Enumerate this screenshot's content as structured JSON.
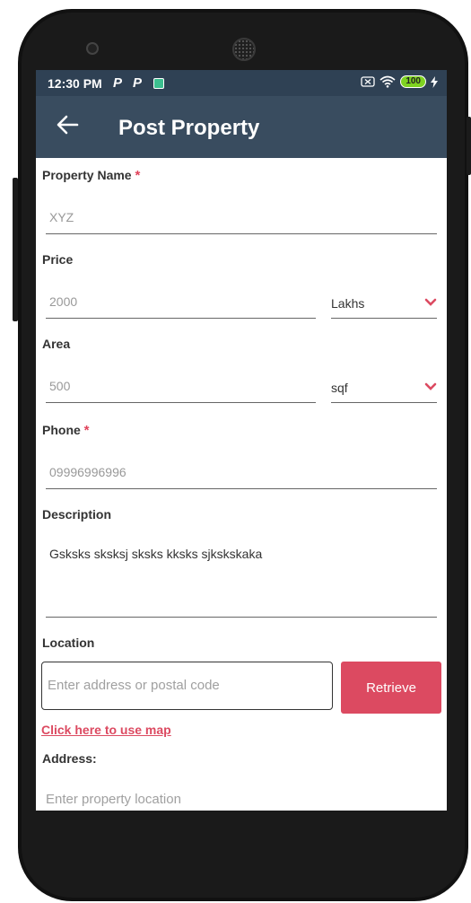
{
  "status_bar": {
    "time": "12:30 PM",
    "notif_icons": [
      "P",
      "P"
    ],
    "battery": "100"
  },
  "app_bar": {
    "title": "Post Property"
  },
  "form": {
    "property_name": {
      "label": "Property Name",
      "required_mark": "*",
      "value": "XYZ"
    },
    "price": {
      "label": "Price",
      "value": "2000",
      "unit": "Lakhs"
    },
    "area": {
      "label": "Area",
      "value": "500",
      "unit": "sqf"
    },
    "phone": {
      "label": "Phone",
      "required_mark": "*",
      "value": "09996996996"
    },
    "description": {
      "label": "Description",
      "value": "Gsksks sksksj sksks kksks sjkskskaka"
    },
    "location": {
      "label": "Location",
      "placeholder": "Enter address or postal code",
      "retrieve_label": "Retrieve",
      "map_link": "Click here to use map"
    },
    "address": {
      "label": "Address:",
      "placeholder": "Enter property location"
    }
  },
  "colors": {
    "app_bar": "#394c5f",
    "status_bar": "#2f4154",
    "accent": "#dc4a61"
  }
}
